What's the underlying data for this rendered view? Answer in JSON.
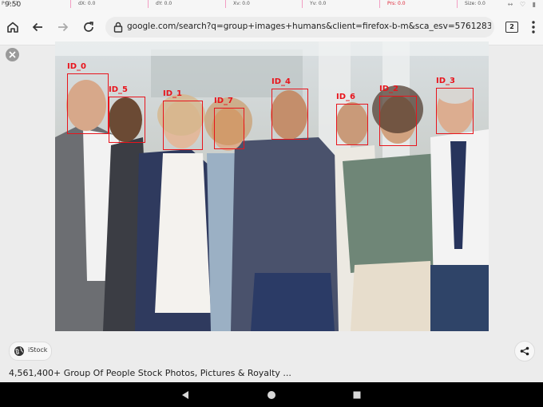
{
  "status_bar": {
    "time": "9:50",
    "overlay": {
      "p": "P: 0 / 1",
      "dx": "dX: 0.0",
      "dy": "dY: 0.0",
      "xv": "Xv: 0.0",
      "yv": "Yv: 0.0",
      "prs": "Prs: 0.0",
      "size": "Size: 0.0"
    }
  },
  "browser": {
    "url": "google.com/search?q=group+images+humans&client=firefox-b-m&sca_esv=576128351&tbm=isch&sou",
    "tab_count": "2",
    "icons": [
      "home-icon",
      "back-icon",
      "forward-icon",
      "reload-icon",
      "lock-icon",
      "menu-icon"
    ]
  },
  "image_viewer": {
    "close_icon": "close-icon",
    "detections": [
      {
        "label": "ID_0"
      },
      {
        "label": "ID_5"
      },
      {
        "label": "ID_1"
      },
      {
        "label": "ID_7"
      },
      {
        "label": "ID_4"
      },
      {
        "label": "ID_6"
      },
      {
        "label": "ID_2"
      },
      {
        "label": "ID_3"
      }
    ],
    "box_color": "#e8141c",
    "source_chip": "iStock",
    "caption": "4,561,400+ Group Of People Stock Photos, Pictures & Royalty ...",
    "share_icon": "share-icon"
  },
  "nav_bar": {
    "icons": [
      "back-triangle-icon",
      "home-circle-icon",
      "recents-square-icon"
    ]
  }
}
